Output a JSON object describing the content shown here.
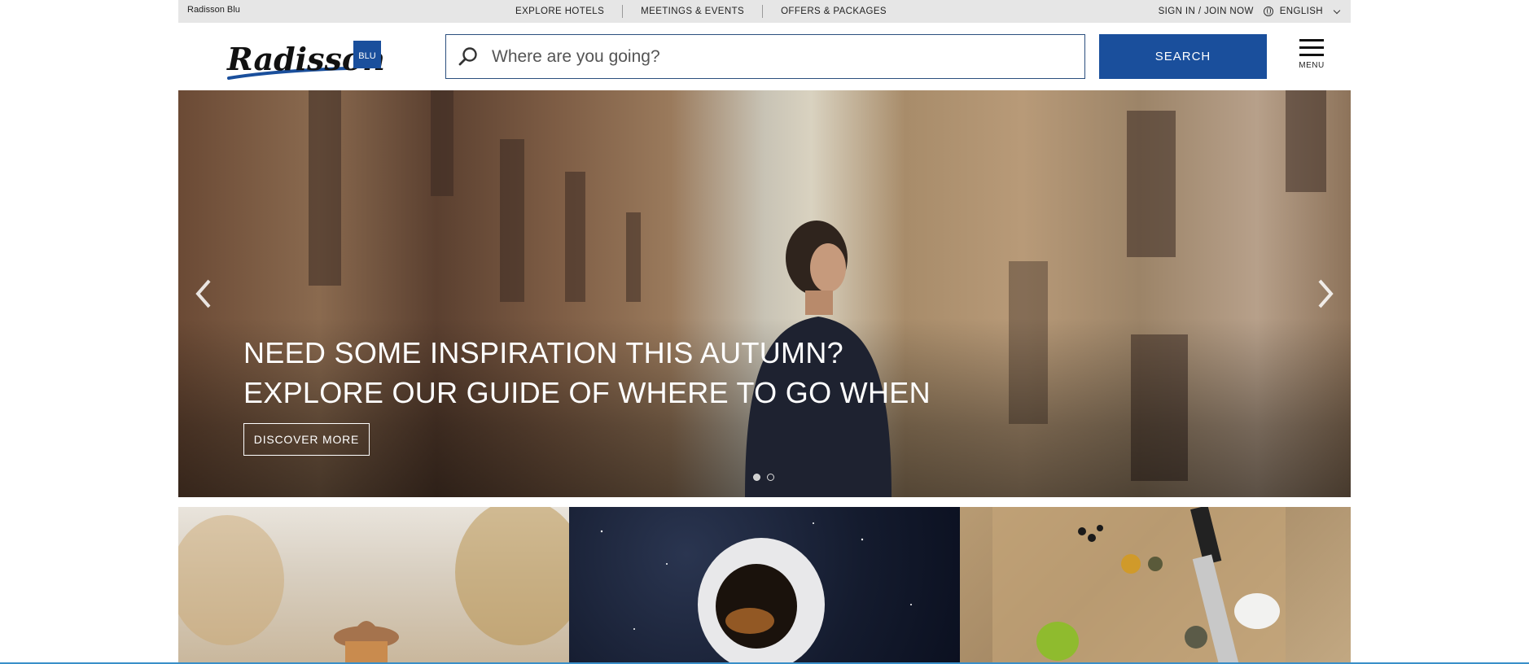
{
  "topbar": {
    "brand": "Radisson Blu",
    "nav": [
      "EXPLORE HOTELS",
      "MEETINGS & EVENTS",
      "OFFERS & PACKAGES"
    ],
    "signin": "SIGN IN / JOIN NOW",
    "language": "ENGLISH"
  },
  "header": {
    "logo_text": "Radisson",
    "logo_badge": "BLU",
    "search_placeholder": "Where are you going?",
    "search_button": "SEARCH",
    "menu_label": "MENU"
  },
  "hero": {
    "title_line1": "NEED SOME INSPIRATION THIS AUTUMN?",
    "title_line2": "EXPLORE OUR GUIDE OF WHERE TO GO WHEN",
    "cta": "DISCOVER MORE",
    "slide_count": 2,
    "active_slide": 1
  },
  "colors": {
    "accent": "#1a4f9c",
    "topbar_bg": "#e6e6e6"
  }
}
